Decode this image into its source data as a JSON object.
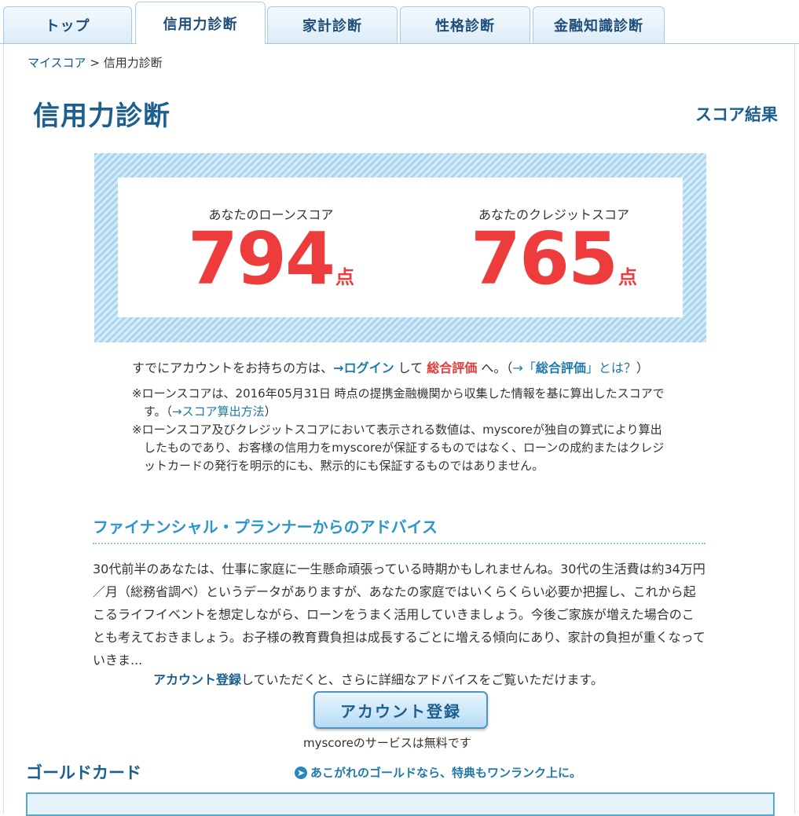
{
  "tabs": [
    {
      "label": "トップ"
    },
    {
      "label": "信用力診断"
    },
    {
      "label": "家計診断"
    },
    {
      "label": "性格診断"
    },
    {
      "label": "金融知識診断"
    }
  ],
  "breadcrumb": {
    "home": "マイスコア",
    "sep": ">",
    "current": "信用力診断"
  },
  "page": {
    "title": "信用力診断",
    "result_label": "スコア結果"
  },
  "scores": {
    "loan": {
      "label": "あなたのローンスコア",
      "value": "794",
      "unit": "点"
    },
    "credit": {
      "label": "あなたのクレジットスコア",
      "value": "765",
      "unit": "点"
    }
  },
  "login_line": {
    "pre": "すでにアカウントをお持ちの方は、",
    "login_link": "→ログイン",
    "mid": " して ",
    "overall": "総合評価",
    "post": " へ。（",
    "what_link_pre": "→「",
    "what_link_bold": "総合評価",
    "what_link_post": "」とは？",
    "close": "）"
  },
  "notes": {
    "n1": "※ローンスコアは、2016年05月31日 時点の提携金融機関から収集した情報を基に算出したスコアです。（",
    "n1_link": "→スコア算出方法",
    "n1_end": "）",
    "n2": "※ローンスコア及びクレジットスコアにおいて表示される数値は、myscoreが独自の算式により算出したものであり、お客様の信用力をmyscoreが保証するものではなく、ローンの成約またはクレジットカードの発行を明示的にも、黙示的にも保証するものではありません。"
  },
  "advice": {
    "heading": "ファイナンシャル・プランナーからのアドバイス",
    "text": "30代前半のあなたは、仕事に家庭に一生懸命頑張っている時期かもしれませんね。30代の生活費は約34万円／月（総務省調べ）というデータがありますが、あなたの家庭ではいくらくらい必要か把握し、これから起こるライフイベントを想定しながら、ローンをうまく活用していきましょう。今後ご家族が増えた場合のことも考えておきましょう。お子様の教育費負担は成長するごとに増える傾向にあり、家計の負担が重くなっていきま...",
    "reg_bold": "アカウント登録",
    "reg_rest": "していただくと、さらに詳細なアドバイスをご覧いただけます。",
    "button": "アカウント登録",
    "free": "myscoreのサービスは無料です"
  },
  "gold": {
    "heading": "ゴールドカード",
    "link": "あこがれのゴールドなら、特典もワンランク上に。",
    "link_icon": "arrow-circle-icon"
  }
}
